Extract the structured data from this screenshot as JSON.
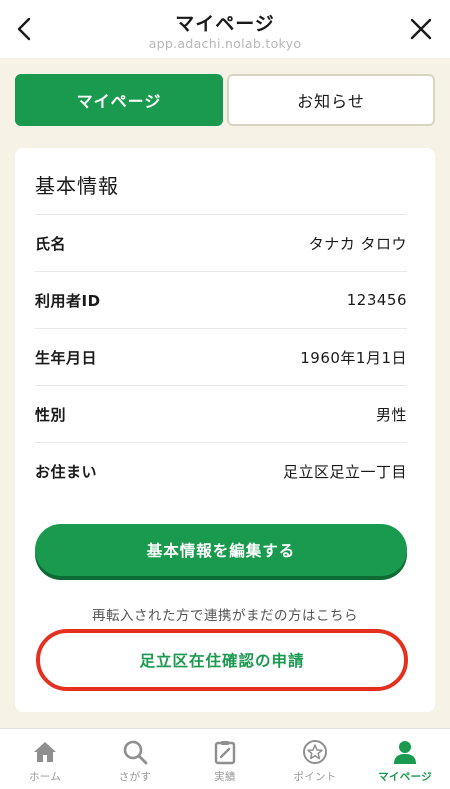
{
  "header": {
    "title": "マイページ",
    "url": "app.adachi.nolab.tokyo"
  },
  "tabs": [
    {
      "label": "マイページ",
      "active": true
    },
    {
      "label": "お知らせ",
      "active": false
    }
  ],
  "basic_info": {
    "title": "基本情報",
    "rows": [
      {
        "label": "氏名",
        "value": "タナカ タロウ"
      },
      {
        "label": "利用者ID",
        "value": "123456"
      },
      {
        "label": "生年月日",
        "value": "1960年1月1日"
      },
      {
        "label": "性別",
        "value": "男性"
      },
      {
        "label": "お住まい",
        "value": "足立区足立一丁目"
      }
    ],
    "edit_button": "基本情報を編集する",
    "note": "再転入された方で連携がまだの方はこちら",
    "verify_button": "足立区在住確認の申請"
  },
  "bottom_nav": [
    {
      "label": "ホーム",
      "icon": "home-icon",
      "active": false
    },
    {
      "label": "さがす",
      "icon": "search-icon",
      "active": false
    },
    {
      "label": "実績",
      "icon": "clipboard-icon",
      "active": false
    },
    {
      "label": "ポイント",
      "icon": "star-badge-icon",
      "active": false
    },
    {
      "label": "マイページ",
      "icon": "user-icon",
      "active": true
    }
  ],
  "colors": {
    "brand_green": "#1a9a4e",
    "highlight_red": "#e4301f",
    "background": "#f6f2e6"
  }
}
